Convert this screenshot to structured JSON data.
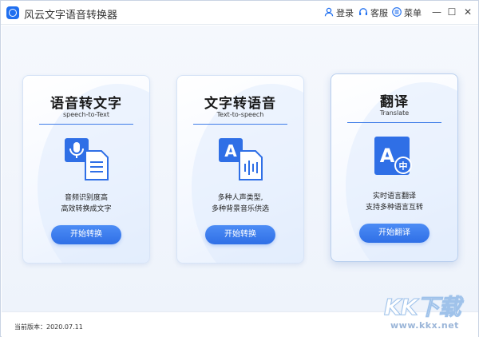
{
  "app": {
    "title": "风云文字语音转换器"
  },
  "header": {
    "login_label": "登录",
    "support_label": "客服",
    "menu_label": "菜单",
    "login_icon": "user-icon",
    "support_icon": "headset-icon",
    "menu_icon": "menu-icon"
  },
  "window_controls": {
    "minimize": "—",
    "maximize": "☐",
    "close": "✕"
  },
  "cards": [
    {
      "title": "语音转文字",
      "subtitle": "speech-to-Text",
      "icon": "microphone-document-icon",
      "desc_line1": "音频识别度高",
      "desc_line2": "高效转换成文字",
      "button": "开始转换"
    },
    {
      "title": "文字转语音",
      "subtitle": "Text-to-speech",
      "icon": "text-to-soundwave-icon",
      "desc_line1": "多种人声类型,",
      "desc_line2": "多种背景音乐供选",
      "button": "开始转换"
    },
    {
      "title": "翻译",
      "subtitle": "Translate",
      "icon": "translate-icon",
      "desc_line1": "实时语言翻译",
      "desc_line2": "支持多种语言互转",
      "button": "开始翻译"
    }
  ],
  "status": {
    "version_text": "当前版本：2020.07.11"
  },
  "watermark": {
    "logo_text": "KK下载",
    "url_text": "www.kkx.net"
  },
  "colors": {
    "accent": "#2f6fe6",
    "icon_blue": "#1f6ff0",
    "watermark": "#9fc2ea"
  }
}
